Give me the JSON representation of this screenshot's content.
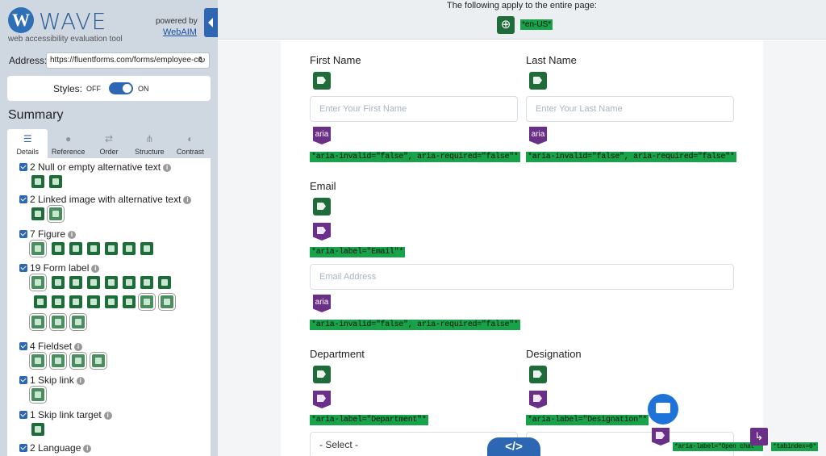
{
  "app": {
    "logo_letter": "W",
    "title": "WAVE",
    "subtitle": "web accessibility evaluation tool",
    "powered_by": "powered by",
    "powered_link": "WebAIM"
  },
  "address": {
    "label": "Address:",
    "value": "https://fluentforms.com/forms/employee-co"
  },
  "styles": {
    "label": "Styles:",
    "off": "OFF",
    "on": "ON",
    "state": "on"
  },
  "summary": {
    "title": "Summary",
    "tabs": [
      {
        "label": "Details",
        "icon": "list-icon",
        "active": true
      },
      {
        "label": "Reference",
        "icon": "info-icon",
        "active": false
      },
      {
        "label": "Order",
        "icon": "order-icon",
        "active": false
      },
      {
        "label": "Structure",
        "icon": "structure-icon",
        "active": false
      },
      {
        "label": "Contrast",
        "icon": "contrast-icon",
        "active": false
      }
    ],
    "categories": [
      {
        "label": "2 Null or empty alternative text"
      },
      {
        "label": "2 Linked image with alternative text"
      },
      {
        "label": "7 Figure"
      },
      {
        "label": "19 Form label"
      },
      {
        "label": "4 Fieldset"
      },
      {
        "label": "1 Skip link"
      },
      {
        "label": "1 Skip link target"
      },
      {
        "label": "2 Language"
      }
    ]
  },
  "topbar": {
    "message": "The following apply to the entire page:",
    "lang_tag": "*en-US*",
    "globe_icon": "globe-icon"
  },
  "form": {
    "first_name": {
      "label": "First Name",
      "placeholder": "Enter Your First Name",
      "aria_text": "aria",
      "tag": "*aria-invalid=\"false\", aria-required=\"false\"*"
    },
    "last_name": {
      "label": "Last Name",
      "placeholder": "Enter Your Last Name",
      "aria_text": "aria",
      "tag": "*aria-invalid=\"false\", aria-required=\"false\"*"
    },
    "email": {
      "label": "Email",
      "label_tag": "*aria-label=\"Email\"*",
      "placeholder": "Email Address",
      "aria_text": "aria",
      "tag": "*aria-invalid=\"false\", aria-required=\"false\"*"
    },
    "department": {
      "label": "Department",
      "label_tag": "*aria-label=\"Department\"*",
      "select_value": "- Select -"
    },
    "designation": {
      "label": "Designation",
      "label_tag": "*aria-label=\"Designation\"*"
    }
  },
  "floating": {
    "chat_tag": "*aria-label=\"Open chat\"*",
    "tabindex_tag": "*tabindex=0*",
    "code_toggle": "</>"
  },
  "colors": {
    "wave_blue": "#2d67b4",
    "sidebar_bg": "#cfd7e1",
    "feature_green": "#1f6b3a",
    "aria_purple": "#6a2f87",
    "tag_green": "#18a34a"
  }
}
